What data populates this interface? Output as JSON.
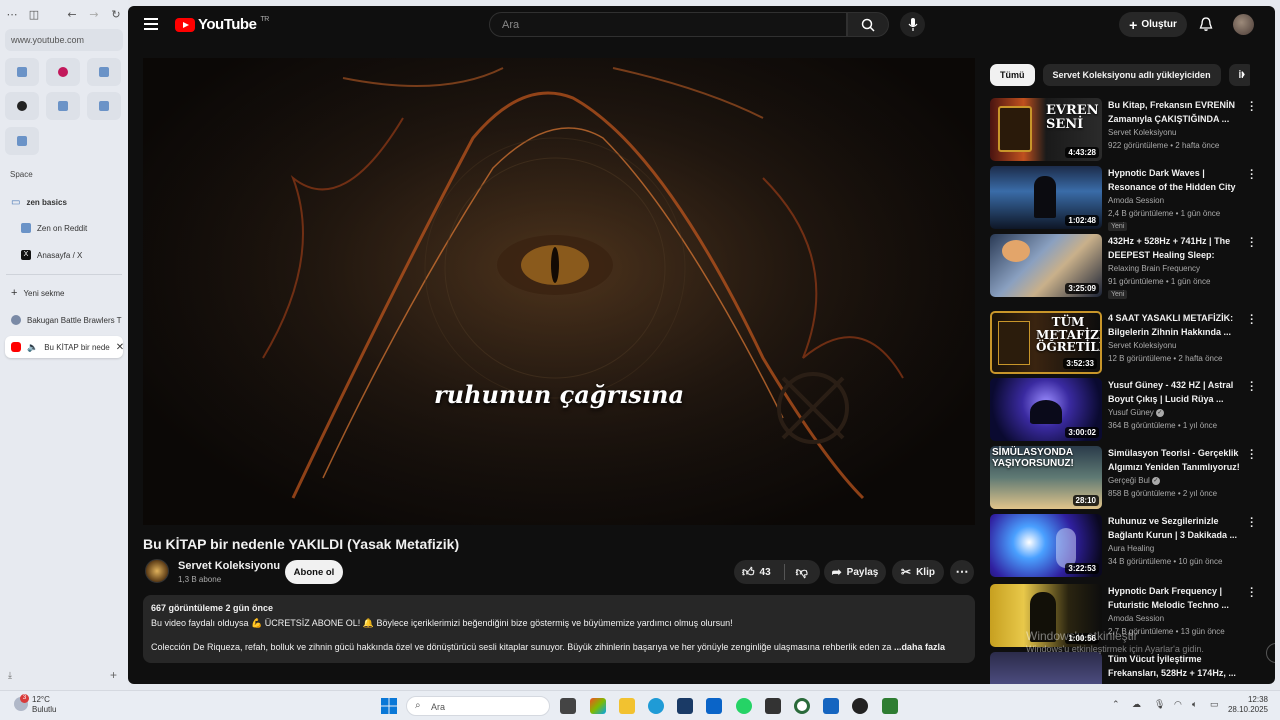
{
  "browser": {
    "url": "www.youtube.com",
    "space_label": "Space",
    "folder_label": "zen basics",
    "folder_items": [
      "Zen on Reddit",
      "Anasayfa / X"
    ],
    "new_tab_label": "Yeni sekme",
    "tabs": [
      "Bakugan Battle Brawlers T",
      "Bu KİTAP bir nede"
    ]
  },
  "youtube": {
    "logo_text": "YouTube",
    "logo_region": "TR",
    "search_placeholder": "Ara",
    "create_label": "Oluştur",
    "video": {
      "subtitle": "ruhunun çağrısına",
      "title": "Bu KİTAP bir nedenle YAKILDI (Yasak Metafizik)",
      "channel": "Servet Koleksiyonu",
      "subscribers": "1,3 B abone",
      "subscribe_label": "Abone ol",
      "likes": "43",
      "share_label": "Paylaş",
      "clip_label": "Klip",
      "description": {
        "meta": "667 görüntüleme  2 gün önce",
        "line1": "Bu video faydalı olduysa 💪 ÜCRETSİZ ABONE OL! 🔔 Böylece içeriklerimizi beğendiğini bize göstermiş ve büyümemize yardımcı olmuş olursun!",
        "line2": "Colección De Riqueza, refah, bolluk ve zihnin gücü hakkında özel ve dönüştürücü sesli kitaplar sunuyor. Büyük zihinlerin başarıya ve her yönüyle zenginliğe ulaşmasına rehberlik eden za",
        "more": "...daha fazla"
      }
    },
    "chips": [
      "Tümü",
      "Servet Koleksiyonu adlı yükleyiciden",
      "İl"
    ],
    "recommendations": [
      {
        "title": "Bu Kitap, Frekansın EVRENİN Zamanıyla ÇAKIŞTIĞINDA ...",
        "channel": "Servet Koleksiyonu",
        "meta": "922 görüntüleme • 2 hafta önce",
        "duration": "4:43:28",
        "thumb_text": "EVREN SENİ",
        "badge": "",
        "verified": false
      },
      {
        "title": "Hypnotic Dark Waves | Resonance of the Hidden City",
        "channel": "Amoda Session",
        "meta": "2,4 B görüntüleme • 1 gün önce",
        "duration": "1:02:48",
        "thumb_text": "",
        "badge": "Yeni",
        "verified": false
      },
      {
        "title": "432Hz + 528Hz + 741Hz  | The DEEPEST Healing Sleep: Whol...",
        "channel": "Relaxing Brain Frequency",
        "meta": "91 görüntüleme • 1 gün önce",
        "duration": "3:25:09",
        "thumb_text": "",
        "badge": "Yeni",
        "verified": false
      },
      {
        "title": "4 SAAT YASAKLI METAFİZİK: Bilgelerin Zihnin Hakkında ...",
        "channel": "Servet Koleksiyonu",
        "meta": "12 B görüntüleme • 2 hafta önce",
        "duration": "3:52:33",
        "thumb_text": "TÜM METAFİZİK ÖĞRETİLER",
        "badge": "",
        "verified": false
      },
      {
        "title": "Yusuf Güney - 432 HZ | Astral Boyut Çıkış | Lucid Rüya ...",
        "channel": "Yusuf Güney",
        "meta": "364 B görüntüleme • 1 yıl önce",
        "duration": "3:00:02",
        "thumb_text": "",
        "badge": "",
        "verified": true
      },
      {
        "title": "Simülasyon Teorisi - Gerçeklik Algımızı Yeniden Tanımlıyoruz!",
        "channel": "Gerçeği Bul",
        "meta": "858 B görüntüleme • 2 yıl önce",
        "duration": "28:10",
        "thumb_text": "SİMÜLASYONDA YAŞIYORSUNUZ!",
        "badge": "",
        "verified": true
      },
      {
        "title": "Ruhunuz ve Sezgilerinizle Bağlantı Kurun | 3 Dakikada ...",
        "channel": "Aura Healing",
        "meta": "34 B görüntüleme • 10 gün önce",
        "duration": "3:22:53",
        "thumb_text": "",
        "badge": "",
        "verified": false
      },
      {
        "title": "Hypnotic Dark Frequency | Futuristic Melodic Techno ...",
        "channel": "Amoda Session",
        "meta": "2,7 B görüntüleme • 13 gün önce",
        "duration": "1:00:56",
        "thumb_text": "",
        "badge": "",
        "verified": false
      },
      {
        "title": "Tüm Vücut İyileştirme Frekansları, 528Hz + 174Hz, ...",
        "channel": "",
        "meta": "",
        "duration": "",
        "thumb_text": "",
        "badge": "",
        "verified": false
      }
    ],
    "watermark_title": "Windows'u etkinleştir",
    "watermark_sub": "Windows'u etkinleştirmek için Ayarlar'a gidin."
  },
  "taskbar": {
    "weather_temp": "12°C",
    "weather_desc": "Bulutlu",
    "weather_badge": "3",
    "search_placeholder": "Ara",
    "time": "12:38",
    "date": "28.10.2025"
  },
  "colors": {
    "yt_red": "#ff0000",
    "yt_bg": "#0f0f0f",
    "surface": "#272727"
  }
}
